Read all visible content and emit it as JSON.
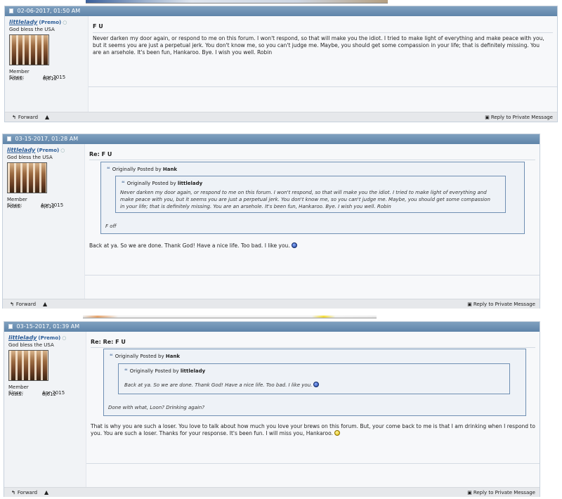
{
  "posts": [
    {
      "date": "02-06-2017, 01:50 AM",
      "user": {
        "name": "littlelady",
        "rank": "(Premo)",
        "tagline": "God bless the USA",
        "member_since_label": "Member Since:",
        "member_since": "Apr 2015",
        "posts_label": "Posts:",
        "posts": "8,612"
      },
      "title": "F U",
      "body": "Never darken my door again, or respond to me on this forum. I won't respond, so that will make you the idiot. I tried to make light of everything and make peace with you, but it seems you are just a perpetual jerk. You don't know me, so you can't judge me. Maybe, you should get some compassion in your life; that is definitely missing. You are an arsehole. It's been fun, Hankaroo. Bye. I wish you well. Robin",
      "forward_label": "Forward",
      "pm_label": "Reply to Private Message"
    },
    {
      "date": "03-15-2017, 01:28 AM",
      "user": {
        "name": "littlelady",
        "rank": "(Premo)",
        "tagline": "God bless the USA",
        "member_since_label": "Member Since:",
        "member_since": "Apr 2015",
        "posts_label": "Posts:",
        "posts": "8,612"
      },
      "title": "Re: F U",
      "quote": {
        "prefix": "Originally Posted by",
        "author": "Hank",
        "inner": {
          "prefix": "Originally Posted by",
          "author": "littlelady",
          "text": "Never darken my door again, or respond to me on this forum. I won't respond, so that will make you the idiot. I tried to make light of everything and make peace with you, but it seems you are just a perpetual jerk. You don't know me, so you can't judge me. Maybe, you should get some compassion in your life; that is definitely missing. You are an arsehole. It's been fun, Hankaroo. Bye. I wish you well. Robin"
        },
        "text": "F off"
      },
      "body": "Back at ya. So we are done. Thank God! Have a nice life. Too bad. I like you.",
      "forward_label": "Forward",
      "pm_label": "Reply to Private Message"
    },
    {
      "date": "03-15-2017, 01:39 AM",
      "user": {
        "name": "littlelady",
        "rank": "(Premo)",
        "tagline": "God bless the USA",
        "member_since_label": "Member Since:",
        "member_since": "Apr 2015",
        "posts_label": "Posts:",
        "posts": "8,612"
      },
      "title": "Re: Re: F U",
      "quote": {
        "prefix": "Originally Posted by",
        "author": "Hank",
        "inner": {
          "prefix": "Originally Posted by",
          "author": "littlelady",
          "text": "Back at ya. So we are done. Thank God! Have a nice life. Too bad. I like you."
        },
        "text": "Done with what, Loon? Drinking again?"
      },
      "body": "That is why you are such a loser. You love to talk about how much you love your brews on this forum. But, your come back to me is that I am drinking when I respond to you. You are such a loser. Thanks for your response. It's been fun. I will miss you, Hankaroo.",
      "forward_label": "Forward",
      "pm_label": "Reply to Private Message"
    }
  ],
  "icons": {
    "forward": "forward-arrow-icon",
    "warn": "warning-triangle-icon",
    "pm": "private-message-icon",
    "quote": "quote-icon",
    "post": "post-document-icon",
    "smiley_blue": "blue-smiley-icon",
    "smiley_yellow": "yellow-smiley-icon"
  }
}
